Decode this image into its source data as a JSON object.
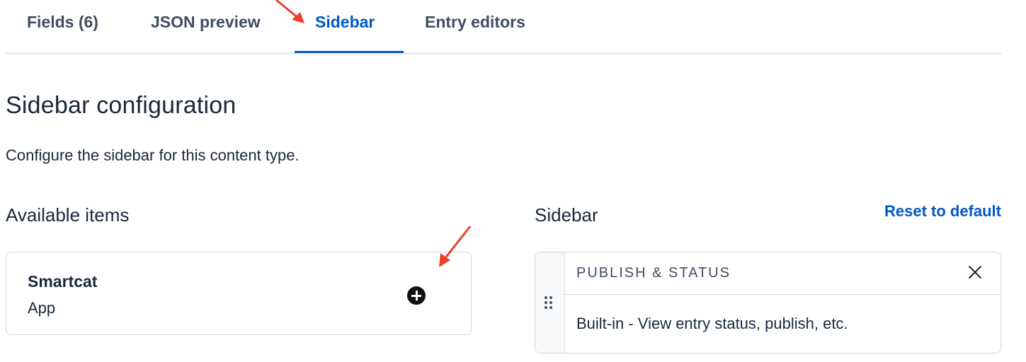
{
  "tabs": [
    {
      "label": "Fields (6)",
      "active": false
    },
    {
      "label": "JSON preview",
      "active": false
    },
    {
      "label": "Sidebar",
      "active": true
    },
    {
      "label": "Entry editors",
      "active": false
    }
  ],
  "page": {
    "title": "Sidebar configuration",
    "description": "Configure the sidebar for this content type."
  },
  "available": {
    "heading": "Available items",
    "items": [
      {
        "name": "Smartcat",
        "type": "App",
        "icon": "plus-circle-icon"
      }
    ]
  },
  "sidebar": {
    "heading": "Sidebar",
    "reset_label": "Reset to default",
    "items": [
      {
        "title": "PUBLISH & STATUS",
        "description": "Built-in - View entry status, publish, etc.",
        "icon": "close-icon"
      }
    ]
  },
  "colors": {
    "accent": "#0059c8",
    "annotation_arrow": "#e8432a",
    "text": "#1b273a",
    "border": "#cfd9e0"
  }
}
